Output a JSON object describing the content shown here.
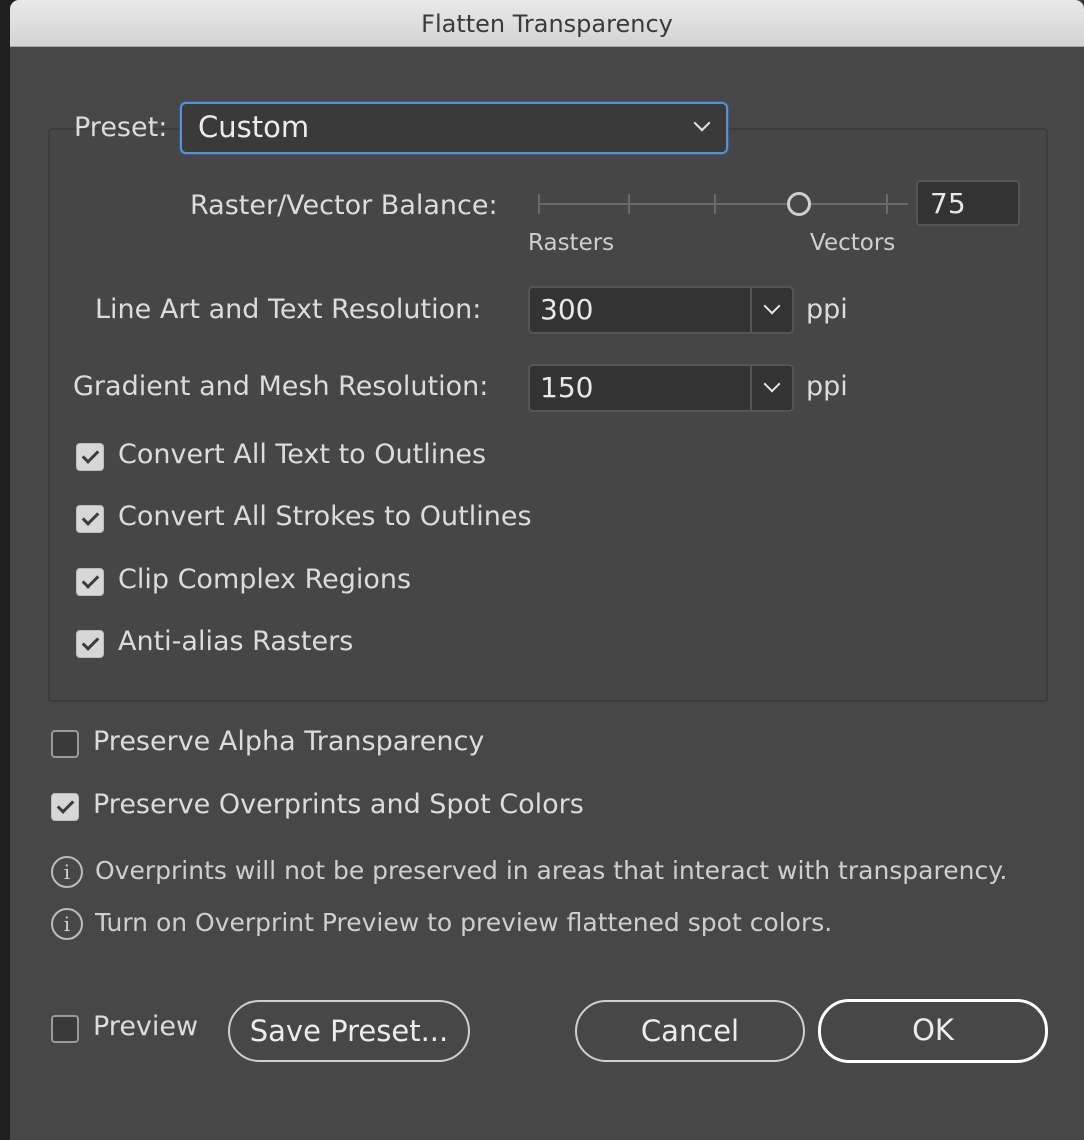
{
  "window": {
    "title": "Flatten Transparency"
  },
  "preset": {
    "label": "Preset:",
    "value": "Custom"
  },
  "balance": {
    "label": "Raster/Vector Balance:",
    "value": "75",
    "level_percent": 75,
    "left_label": "Rasters",
    "right_label": "Vectors"
  },
  "line_art": {
    "label": "Line Art and Text Resolution:",
    "value": "300",
    "unit": "ppi"
  },
  "gradient": {
    "label": "Gradient and Mesh Resolution:",
    "value": "150",
    "unit": "ppi"
  },
  "options": [
    {
      "label": "Convert All Text to Outlines",
      "checked": true
    },
    {
      "label": "Convert All Strokes to Outlines",
      "checked": true
    },
    {
      "label": "Clip Complex Regions",
      "checked": true
    },
    {
      "label": "Anti-alias Rasters",
      "checked": true
    }
  ],
  "preserve_alpha": {
    "label": "Preserve Alpha Transparency",
    "checked": false
  },
  "preserve_overprints": {
    "label": "Preserve Overprints and Spot Colors",
    "checked": true
  },
  "notes": [
    "Overprints will not be preserved in areas that interact with transparency.",
    "Turn on Overprint Preview to preview flattened spot colors."
  ],
  "footer": {
    "preview_label": "Preview",
    "preview_checked": false,
    "save_preset": "Save Preset...",
    "cancel": "Cancel",
    "ok": "OK"
  },
  "colors": {
    "focus_ring": "#5b90c9",
    "dialog_bg": "#474747"
  }
}
